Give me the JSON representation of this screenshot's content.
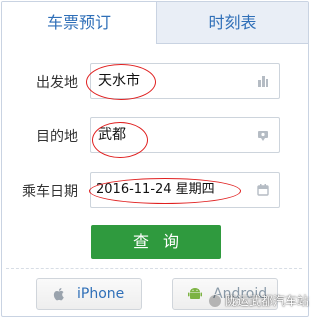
{
  "tabs": [
    {
      "label": "车票预订",
      "active": true
    },
    {
      "label": "时刻表",
      "active": false
    }
  ],
  "form": {
    "departure": {
      "label": "出发地",
      "value": "天水市",
      "icon": "building-icon"
    },
    "destination": {
      "label": "目的地",
      "value": "武都",
      "icon": "location-icon"
    },
    "date": {
      "label": "乘车日期",
      "value": "2016-11-24 星期四",
      "icon": "calendar-icon"
    }
  },
  "query_button": "查询",
  "apps": {
    "iphone": {
      "label": "iPhone",
      "icon": "apple-icon"
    },
    "android": {
      "label": "Android",
      "icon": "android-icon"
    }
  },
  "watermark": "陇运武都汽车站",
  "colors": {
    "tab_text": "#2f6fb8",
    "query_button": "#2f9a3e",
    "annotation_circle": "#e02020"
  }
}
